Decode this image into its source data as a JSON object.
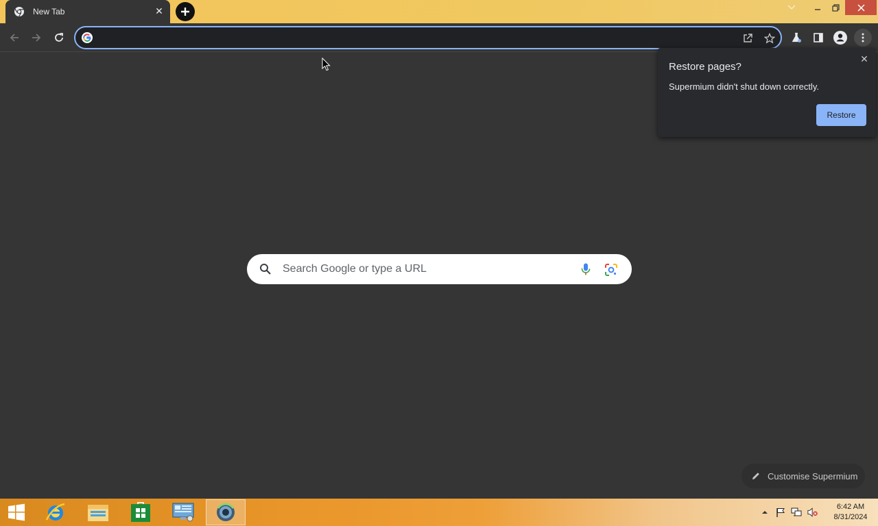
{
  "window": {
    "tab_title": "New Tab",
    "tab_close_glyph": "✕",
    "new_tab_glyph": "+",
    "minimize_glyph": "—",
    "restore_glyph": "❐",
    "close_glyph": "✕"
  },
  "toolbar": {
    "omnibox_value": "",
    "icons": [
      "back-icon",
      "forward-icon",
      "reload-icon",
      "share-icon",
      "bookmark-star-icon",
      "labs-flask-icon",
      "side-panel-icon",
      "profile-icon",
      "menu-icon"
    ]
  },
  "restore_popup": {
    "title": "Restore pages?",
    "message": "Supermium didn't shut down correctly.",
    "button_label": "Restore",
    "close_glyph": "✕"
  },
  "search": {
    "placeholder": "Search Google or type a URL"
  },
  "customise": {
    "label": "Customise Supermium"
  },
  "taskbar": {
    "apps": [
      "start-button",
      "internet-explorer",
      "file-explorer",
      "store",
      "control-panel",
      "supermium-browser"
    ],
    "clock_time": "6:42 AM",
    "clock_date": "8/31/2024"
  },
  "colors": {
    "accent": "#8ab4f8",
    "page_background": "#353535",
    "titlebar": "#f0c860",
    "close_button": "#c7503f"
  }
}
